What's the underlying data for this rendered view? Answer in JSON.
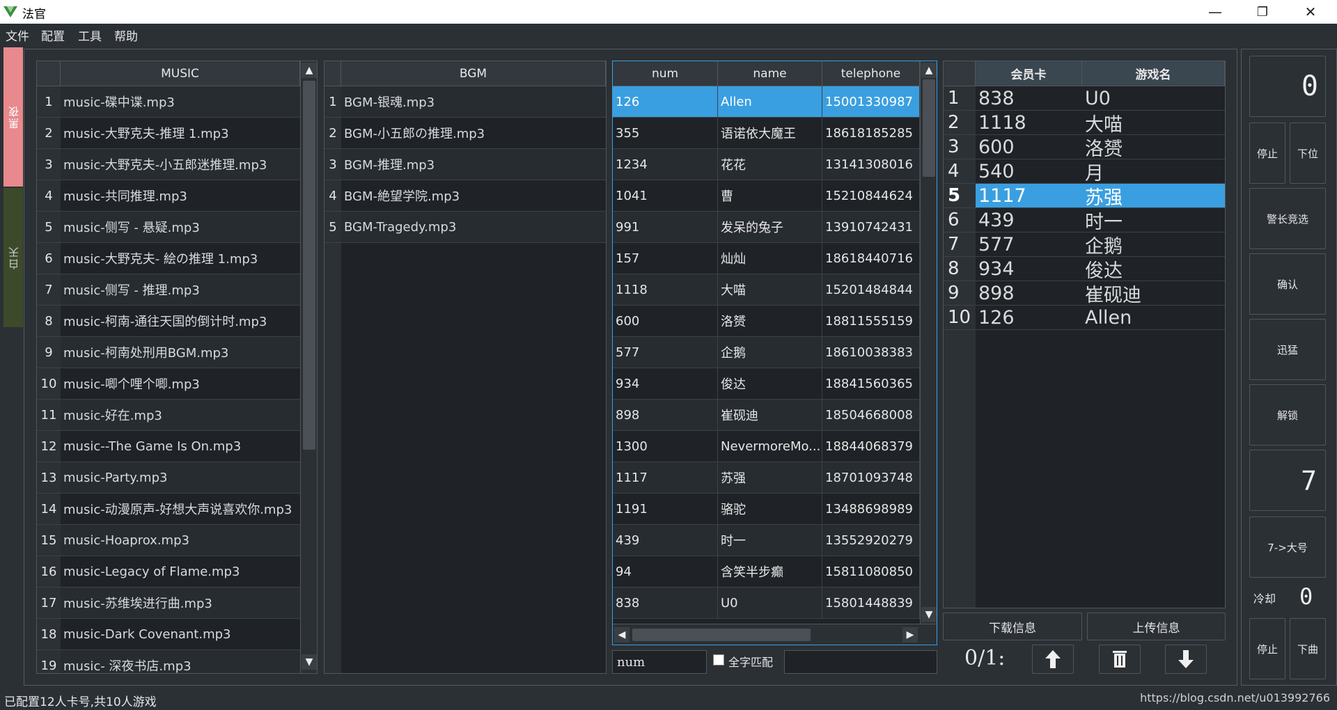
{
  "window": {
    "title": "法官",
    "minimize": "—",
    "restore": "❐",
    "close": "✕"
  },
  "menu": [
    "文件",
    "配置",
    "工具",
    "帮助"
  ],
  "side_tabs": {
    "night": "黑夜",
    "day": "白天"
  },
  "music_table": {
    "header": "MUSIC",
    "rows": [
      {
        "n": "1",
        "name": "music-碟中谍.mp3"
      },
      {
        "n": "2",
        "name": "music-大野克夫-推理 1.mp3"
      },
      {
        "n": "3",
        "name": "music-大野克夫-小五郎迷推理.mp3"
      },
      {
        "n": "4",
        "name": "music-共同推理.mp3"
      },
      {
        "n": "5",
        "name": "music-侧写 - 悬疑.mp3"
      },
      {
        "n": "6",
        "name": "music-大野克夫- 絵の推理 1.mp3"
      },
      {
        "n": "7",
        "name": "music-侧写 - 推理.mp3"
      },
      {
        "n": "8",
        "name": "music-柯南-通往天国的倒计时.mp3"
      },
      {
        "n": "9",
        "name": "music-柯南处刑用BGM.mp3"
      },
      {
        "n": "10",
        "name": "music-唧个哩个唧.mp3"
      },
      {
        "n": "11",
        "name": "music-好在.mp3"
      },
      {
        "n": "12",
        "name": "music--The Game Is On.mp3"
      },
      {
        "n": "13",
        "name": "music-Party.mp3"
      },
      {
        "n": "14",
        "name": "music-动漫原声-好想大声说喜欢你.mp3"
      },
      {
        "n": "15",
        "name": "music-Hoaprox.mp3"
      },
      {
        "n": "16",
        "name": "music-Legacy of Flame.mp3"
      },
      {
        "n": "17",
        "name": "music-苏维埃进行曲.mp3"
      },
      {
        "n": "18",
        "name": "music-Dark Covenant.mp3"
      },
      {
        "n": "19",
        "name": "music- 深夜书店.mp3"
      }
    ]
  },
  "bgm_table": {
    "header": "BGM",
    "rows": [
      {
        "n": "1",
        "name": "BGM-银魂.mp3"
      },
      {
        "n": "2",
        "name": "BGM-小五郎の推理.mp3"
      },
      {
        "n": "3",
        "name": "BGM-推理.mp3"
      },
      {
        "n": "4",
        "name": "BGM-絶望学院.mp3"
      },
      {
        "n": "5",
        "name": "BGM-Tragedy.mp3"
      }
    ]
  },
  "member_table": {
    "headers": [
      "num",
      "name",
      "telephone"
    ],
    "rows": [
      {
        "num": "126",
        "name": "Allen",
        "tel": "15001330987"
      },
      {
        "num": "355",
        "name": "语诺依大魔王",
        "tel": "18618185285"
      },
      {
        "num": "1234",
        "name": "花花",
        "tel": "13141308016"
      },
      {
        "num": "1041",
        "name": "曹",
        "tel": "15210844624"
      },
      {
        "num": "991",
        "name": "发呆的兔子",
        "tel": "13910742431"
      },
      {
        "num": "157",
        "name": "灿灿",
        "tel": "18618440716"
      },
      {
        "num": "1118",
        "name": "大喵",
        "tel": "15201484844"
      },
      {
        "num": "600",
        "name": "洛赟",
        "tel": "18811555159"
      },
      {
        "num": "577",
        "name": "企鹅",
        "tel": "18610038383"
      },
      {
        "num": "934",
        "name": "俊达",
        "tel": "18841560365"
      },
      {
        "num": "898",
        "name": "崔砚迪",
        "tel": "18504668008"
      },
      {
        "num": "1300",
        "name": "NevermoreMo...",
        "tel": "18844068379"
      },
      {
        "num": "1117",
        "name": "苏强",
        "tel": "18701093748"
      },
      {
        "num": "1191",
        "name": "骆驼",
        "tel": "13488698989"
      },
      {
        "num": "439",
        "name": "时一",
        "tel": "13552920279"
      },
      {
        "num": "94",
        "name": "含笑半步癫",
        "tel": "15811080850"
      },
      {
        "num": "838",
        "name": "U0",
        "tel": "15801448839"
      }
    ]
  },
  "search": {
    "field_value": "num",
    "fullmatch_label": "全字匹配",
    "query_value": ""
  },
  "game_table": {
    "headers": [
      "会员卡",
      "游戏名"
    ],
    "rows": [
      {
        "n": "1",
        "card": "838",
        "name": "U0"
      },
      {
        "n": "2",
        "card": "1118",
        "name": "大喵"
      },
      {
        "n": "3",
        "card": "600",
        "name": "洛赟"
      },
      {
        "n": "4",
        "card": "540",
        "name": "月"
      },
      {
        "n": "5",
        "card": "1117",
        "name": "苏强"
      },
      {
        "n": "6",
        "card": "439",
        "name": "时一"
      },
      {
        "n": "7",
        "card": "577",
        "name": "企鹅"
      },
      {
        "n": "8",
        "card": "934",
        "name": "俊达"
      },
      {
        "n": "9",
        "card": "898",
        "name": "崔砚迪"
      },
      {
        "n": "10",
        "card": "126",
        "name": "Allen"
      }
    ]
  },
  "game_actions": {
    "download": "下载信息",
    "upload": "上传信息",
    "counter": "0/1:"
  },
  "right_panel": {
    "lcd_top": "0",
    "stop": "停止",
    "next_pos": "下位",
    "sheriff": "警长竞选",
    "confirm": "确认",
    "fierce": "迅猛",
    "unlock": "解锁",
    "lcd_mid": "7",
    "big_num": "7->大号",
    "cooldown_label": "冷却",
    "cooldown_value": "0",
    "stop2": "停止",
    "next_song": "下曲"
  },
  "status": {
    "message": "已配置12人卡号,共10人游戏",
    "watermark": "https://blog.csdn.net/u013992766"
  },
  "colors": {
    "selection": "#3a9fe0",
    "night_tab": "#e8898d",
    "day_tab": "#3c4a2a"
  }
}
